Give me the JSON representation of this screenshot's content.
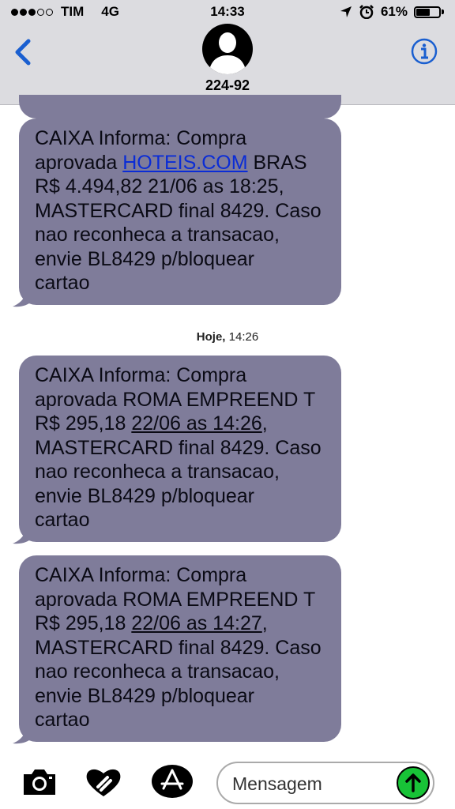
{
  "status_bar": {
    "carrier": "TIM",
    "network": "4G",
    "time": "14:33",
    "battery": "61%",
    "battery_level": 0.61
  },
  "header": {
    "contact_name": "224-92",
    "back_icon": "chevron-left-icon",
    "info_icon": "info-circle-icon",
    "avatar_icon": "person-silhouette-icon"
  },
  "messages": [
    {
      "lines": [
        [
          "CAIXA Informa: Compra"
        ],
        [
          "aprovada ",
          "HOTEIS.COM",
          " BRAS"
        ],
        [
          "R$ 4.494,82 21/06 as 18:25,"
        ],
        [
          "MASTERCARD final 8429. Caso"
        ],
        [
          "nao reconheca a transacao,"
        ],
        [
          "envie BL8429 p/bloquear"
        ],
        [
          "cartao"
        ]
      ]
    },
    {
      "lines": [
        [
          "CAIXA Informa: Compra"
        ],
        [
          "aprovada ROMA EMPREEND T"
        ],
        [
          "R$ 295,18 ",
          "22/06 as 14:26",
          ","
        ],
        [
          "MASTERCARD final 8429. Caso"
        ],
        [
          "nao reconheca a transacao,"
        ],
        [
          "envie BL8429 p/bloquear"
        ],
        [
          "cartao"
        ]
      ]
    },
    {
      "lines": [
        [
          "CAIXA Informa: Compra"
        ],
        [
          "aprovada ROMA EMPREEND T"
        ],
        [
          "R$ 295,18 ",
          "22/06 as 14:27",
          ","
        ],
        [
          "MASTERCARD final 8429. Caso"
        ],
        [
          "nao reconheca a transacao,"
        ],
        [
          "envie BL8429 p/bloquear"
        ],
        [
          "cartao"
        ]
      ]
    }
  ],
  "timestamp": {
    "day": "Hoje,",
    "time": "14:26"
  },
  "input_bar": {
    "placeholder": "Mensagem",
    "camera_icon": "camera-icon",
    "digital_touch_icon": "heart-digital-touch-icon",
    "apps_icon": "app-store-icon",
    "send_icon": "arrow-up-send-icon"
  },
  "colors": {
    "bubble": "#7f7c9a",
    "link": "#0a2cd6",
    "accent": "#1a5fd0",
    "send": "#18c337"
  }
}
